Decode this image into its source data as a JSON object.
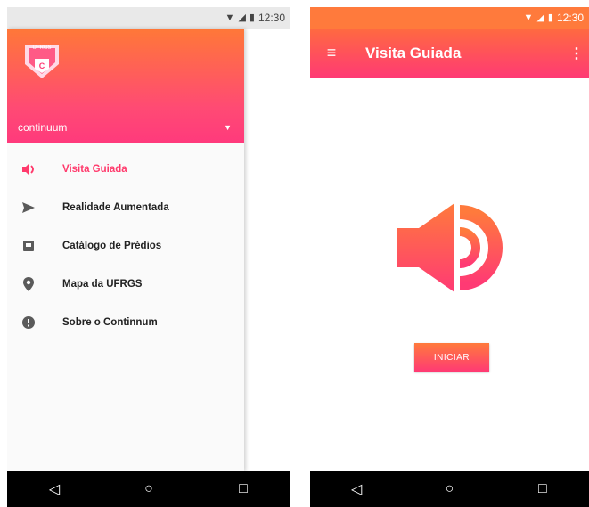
{
  "colors": {
    "accent_orange": "#ff7a3c",
    "accent_pink": "#ff3a74",
    "active_item": "#ff3a6c"
  },
  "status_bar": {
    "time": "12:30",
    "icons": [
      "wifi-icon",
      "signal-icon",
      "battery-icon"
    ]
  },
  "drawer": {
    "logo_text": "UFRGS",
    "logo_letter": "C",
    "account_name": "continuum",
    "items": [
      {
        "label": "Visita Guiada",
        "icon": "speaker-icon",
        "active": true
      },
      {
        "label": "Realidade Aumentada",
        "icon": "send-icon",
        "active": false
      },
      {
        "label": "Catálogo de Prédios",
        "icon": "catalog-icon",
        "active": false
      },
      {
        "label": "Mapa da UFRGS",
        "icon": "location-pin-icon",
        "active": false
      },
      {
        "label": "Sobre o Continnum",
        "icon": "info-icon",
        "active": false
      }
    ]
  },
  "main": {
    "title": "Visita Guiada",
    "start_button": "INICIAR"
  },
  "nav": {
    "icons": [
      "back-icon",
      "home-icon",
      "recents-icon"
    ]
  }
}
